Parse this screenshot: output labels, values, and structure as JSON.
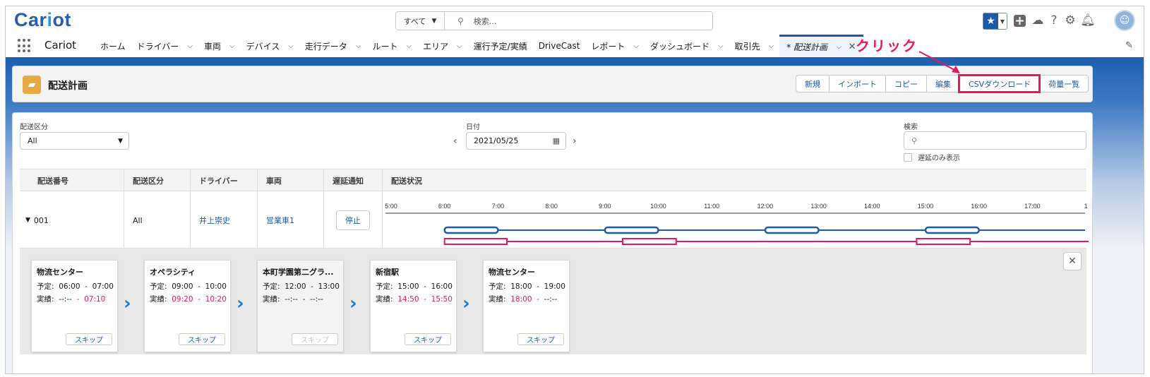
{
  "header": {
    "logo_main": "Car",
    "logo_o": "i",
    "logo_end": "ot",
    "search_scope": "すべて",
    "search_placeholder": "検索..."
  },
  "nav": {
    "app_name": "Cariot",
    "items": [
      {
        "label": "ホーム",
        "dropdown": false
      },
      {
        "label": "ドライバー",
        "dropdown": true
      },
      {
        "label": "車両",
        "dropdown": true
      },
      {
        "label": "デバイス",
        "dropdown": true
      },
      {
        "label": "走行データ",
        "dropdown": true
      },
      {
        "label": "ルート",
        "dropdown": true
      },
      {
        "label": "エリア",
        "dropdown": true
      },
      {
        "label": "運行予定/実績",
        "dropdown": false
      },
      {
        "label": "DriveCast",
        "dropdown": false
      },
      {
        "label": "レポート",
        "dropdown": true
      },
      {
        "label": "ダッシュボード",
        "dropdown": true
      },
      {
        "label": "取引先",
        "dropdown": true
      }
    ],
    "active_tab": "* 配送計画"
  },
  "page": {
    "title": "配送計画",
    "buttons": [
      "新規",
      "インポート",
      "コピー",
      "編集",
      "CSVダウンロード",
      "荷量一覧"
    ],
    "highlighted_button": "CSVダウンロード",
    "annotation": "クリック",
    "accent_color": "#e8185b"
  },
  "filters": {
    "category_label": "配送区分",
    "category_value": "All",
    "date_label": "日付",
    "date_value": "2021/05/25",
    "search_label": "検索",
    "delay_only_label": "遅延のみ表示"
  },
  "table": {
    "headers": [
      "配送番号",
      "配送区分",
      "ドライバー",
      "車両",
      "遅延通知",
      "配送状況"
    ],
    "row": {
      "number": "001",
      "category": "All",
      "driver": "井上崇史",
      "vehicle": "営業車1",
      "stop_button": "停止"
    },
    "timeline_ticks": [
      "5:00",
      "6:00",
      "7:00",
      "8:00",
      "9:00",
      "10:00",
      "11:00",
      "12:00",
      "13:00",
      "14:00",
      "15:00",
      "16:00",
      "17:00",
      "1"
    ]
  },
  "stops": [
    {
      "name": "物流センター",
      "plan_label": "予定:",
      "plan_from": "06:00",
      "plan_to": "07:00",
      "actual_label": "実績:",
      "actual_from": "--:--",
      "actual_to": "07:10",
      "actual_from_red": false,
      "actual_to_red": true,
      "skip": "スキップ",
      "disabled": false
    },
    {
      "name": "オペラシティ",
      "plan_label": "予定:",
      "plan_from": "09:00",
      "plan_to": "10:00",
      "actual_label": "実績:",
      "actual_from": "09:20",
      "actual_to": "10:20",
      "actual_from_red": true,
      "actual_to_red": true,
      "skip": "スキップ",
      "disabled": false
    },
    {
      "name": "本町学園第二グラ...",
      "plan_label": "予定:",
      "plan_from": "12:00",
      "plan_to": "13:00",
      "actual_label": "実績:",
      "actual_from": "--:--",
      "actual_to": "--:--",
      "actual_from_red": false,
      "actual_to_red": false,
      "skip": "スキップ",
      "disabled": true
    },
    {
      "name": "新宿駅",
      "plan_label": "予定:",
      "plan_from": "15:00",
      "plan_to": "16:00",
      "actual_label": "実績:",
      "actual_from": "14:50",
      "actual_to": "15:50",
      "actual_from_red": true,
      "actual_to_red": true,
      "skip": "スキップ",
      "disabled": false
    },
    {
      "name": "物流センター",
      "plan_label": "予定:",
      "plan_from": "18:00",
      "plan_to": "19:00",
      "actual_label": "実績:",
      "actual_from": "18:00",
      "actual_to": "--:--",
      "actual_from_red": true,
      "actual_to_red": false,
      "skip": "スキップ",
      "disabled": false
    }
  ],
  "timeline": {
    "plan_color": "#1b5aa8",
    "actual_color": "#e8185b",
    "plan_segments": [
      [
        "06:00",
        "07:00"
      ],
      [
        "09:00",
        "10:00"
      ],
      [
        "12:00",
        "13:00"
      ],
      [
        "15:00",
        "16:00"
      ]
    ],
    "actual_segments": [
      [
        "06:00",
        "07:10"
      ],
      [
        "09:20",
        "10:20"
      ],
      [
        "14:50",
        "15:50"
      ]
    ]
  }
}
